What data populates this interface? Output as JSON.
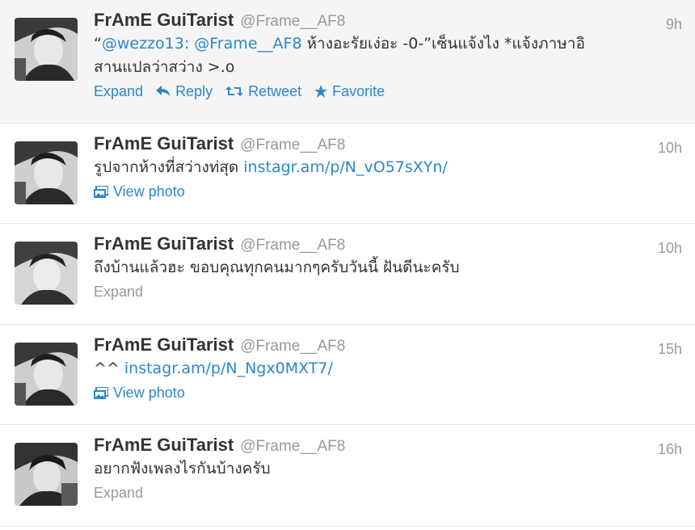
{
  "tweets": [
    {
      "name": "FrAmE GuiTarist",
      "handle": "@Frame__AF8",
      "time": "9h",
      "highlighted": true,
      "text_parts": [
        "“",
        "@wezzo13: @Frame__AF8",
        " ห้างอะรัยเง่อะ -0-”เซ็นแจ้งไง *แจ้งภาษาอิ",
        "สานแปลว่าสว่าง >.o"
      ],
      "actions": {
        "expand": "Expand",
        "reply": "Reply",
        "retweet": "Retweet",
        "favorite": "Favorite"
      }
    },
    {
      "name": "FrAmE GuiTarist",
      "handle": "@Frame__AF8",
      "time": "10h",
      "text": "รูปจากห้างที่สว่างท่สุด ",
      "link": "instagr.am/p/N_vO57sXYn/",
      "action": "View photo"
    },
    {
      "name": "FrAmE GuiTarist",
      "handle": "@Frame__AF8",
      "time": "10h",
      "text": "ถึงบ้านแล้วฮะ ขอบคุณทุกคนมากๆครับวันนี้ ฝันดีนะครับ",
      "action": "Expand"
    },
    {
      "name": "FrAmE GuiTarist",
      "handle": "@Frame__AF8",
      "time": "15h",
      "text": "^^ ",
      "link": "instagr.am/p/N_Ngx0MXT7/",
      "action": "View photo"
    },
    {
      "name": "FrAmE GuiTarist",
      "handle": "@Frame__AF8",
      "time": "16h",
      "text": "อยากฟังเพลงไรกันบ้างครับ",
      "action": "Expand"
    }
  ],
  "colors": {
    "link": "#2b87c8",
    "muted": "#999999",
    "highlight_bg": "#f5f5f5"
  },
  "icons": [
    "reply-arrow-icon",
    "retweet-icon",
    "star-icon",
    "photo-icon"
  ]
}
